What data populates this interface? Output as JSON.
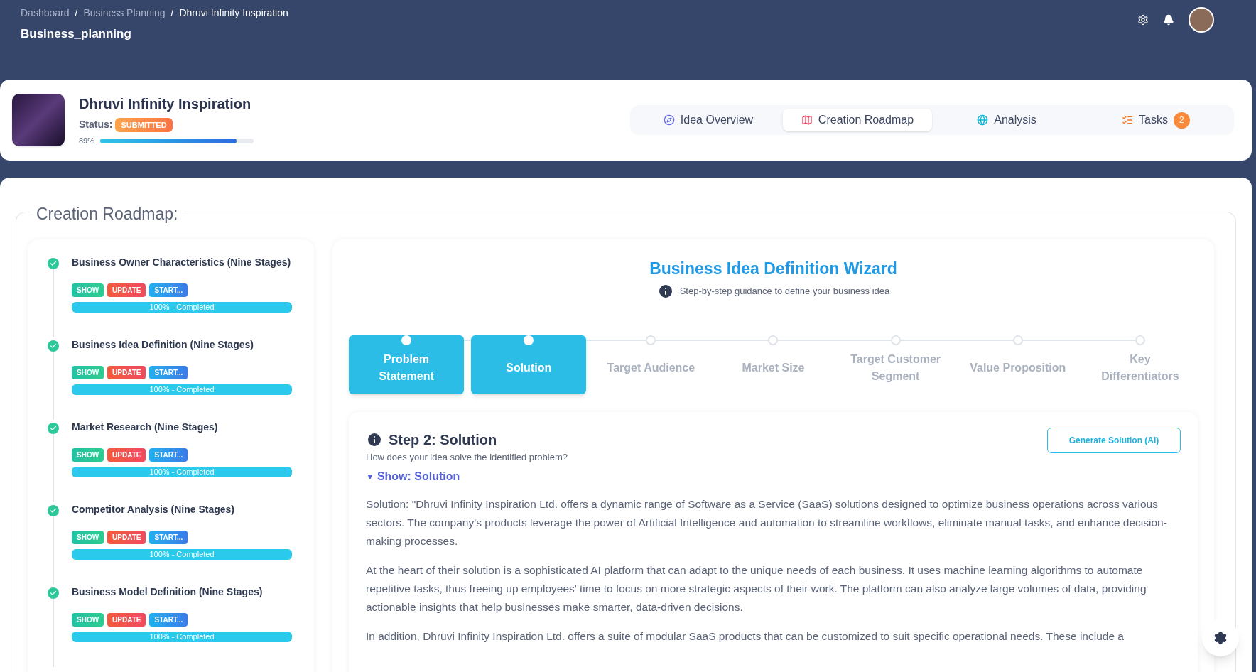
{
  "breadcrumb_separator": "/",
  "breadcrumb": [
    {
      "label": "Dashboard",
      "current": false
    },
    {
      "label": "Business Planning",
      "current": false
    },
    {
      "label": "Dhruvi Infinity Inspiration",
      "current": true
    }
  ],
  "page_title": "Business_planning",
  "project": {
    "name": "Dhruvi Infinity Inspiration",
    "status_label": "Status:",
    "status": "SUBMITTED",
    "progress_text": "89%",
    "level": 0.89
  },
  "tabs": [
    {
      "label": "Idea Overview",
      "selected": false
    },
    {
      "label": "Creation Roadmap",
      "selected": true
    },
    {
      "label": "Analysis",
      "selected": false
    },
    {
      "label": "Tasks",
      "selected": false,
      "badge": "2"
    }
  ],
  "section_title": "Creation Roadmap:",
  "roadmap": [
    {
      "title": "Business Owner Characteristics (Nine Stages)",
      "done": true,
      "buttons": [
        "SHOW",
        "UPDATE",
        "START..."
      ],
      "progress_text": "100% - Completed",
      "level": 1
    },
    {
      "title": "Business Idea Definition (Nine Stages)",
      "done": true,
      "buttons": [
        "SHOW",
        "UPDATE",
        "START..."
      ],
      "progress_text": "100% - Completed",
      "level": 1
    },
    {
      "title": "Market Research (Nine Stages)",
      "done": true,
      "buttons": [
        "SHOW",
        "UPDATE",
        "START..."
      ],
      "progress_text": "100% - Completed",
      "level": 1
    },
    {
      "title": "Competitor Analysis (Nine Stages)",
      "done": true,
      "buttons": [
        "SHOW",
        "UPDATE",
        "START..."
      ],
      "progress_text": "100% - Completed",
      "level": 1
    },
    {
      "title": "Business Model Definition (Nine Stages)",
      "done": true,
      "buttons": [
        "SHOW",
        "UPDATE",
        "START..."
      ],
      "progress_text": "100% - Completed",
      "level": 1
    }
  ],
  "wizard": {
    "title": "Business Idea Definition Wizard",
    "subtitle": "Step-by-step guidance to define your business idea",
    "steps": [
      {
        "label": "Problem Statement",
        "reached": true
      },
      {
        "label": "Solution",
        "reached": true
      },
      {
        "label": "Target Audience",
        "reached": false
      },
      {
        "label": "Market Size",
        "reached": false
      },
      {
        "label": "Target Customer Segment",
        "reached": false
      },
      {
        "label": "Value Proposition",
        "reached": false
      },
      {
        "label": "Key Differentiators",
        "reached": false
      }
    ],
    "step_title": "Step 2: Solution",
    "step_question": "How does your idea solve the identified problem?",
    "generate_button": "Generate Solution (AI)",
    "toggle": {
      "arrow": "▼",
      "label": "Show: Solution",
      "expanded": true
    },
    "paragraphs": [
      "Solution: \"Dhruvi Infinity Inspiration Ltd. offers a dynamic range of Software as a Service (SaaS) solutions designed to optimize business operations across various sectors. The company's products leverage the power of Artificial Intelligence and automation to streamline workflows, eliminate manual tasks, and enhance decision-making processes.",
      "At the heart of their solution is a sophisticated AI platform that can adapt to the unique needs of each business. It uses machine learning algorithms to automate repetitive tasks, thus freeing up employees' time to focus on more strategic aspects of their work. The platform can also analyze large volumes of data, providing actionable insights that help businesses make smarter, data-driven decisions.",
      "In addition, Dhruvi Infinity Inspiration Ltd. offers a suite of modular SaaS products that can be customized to suit specific operational needs. These include a"
    ]
  }
}
